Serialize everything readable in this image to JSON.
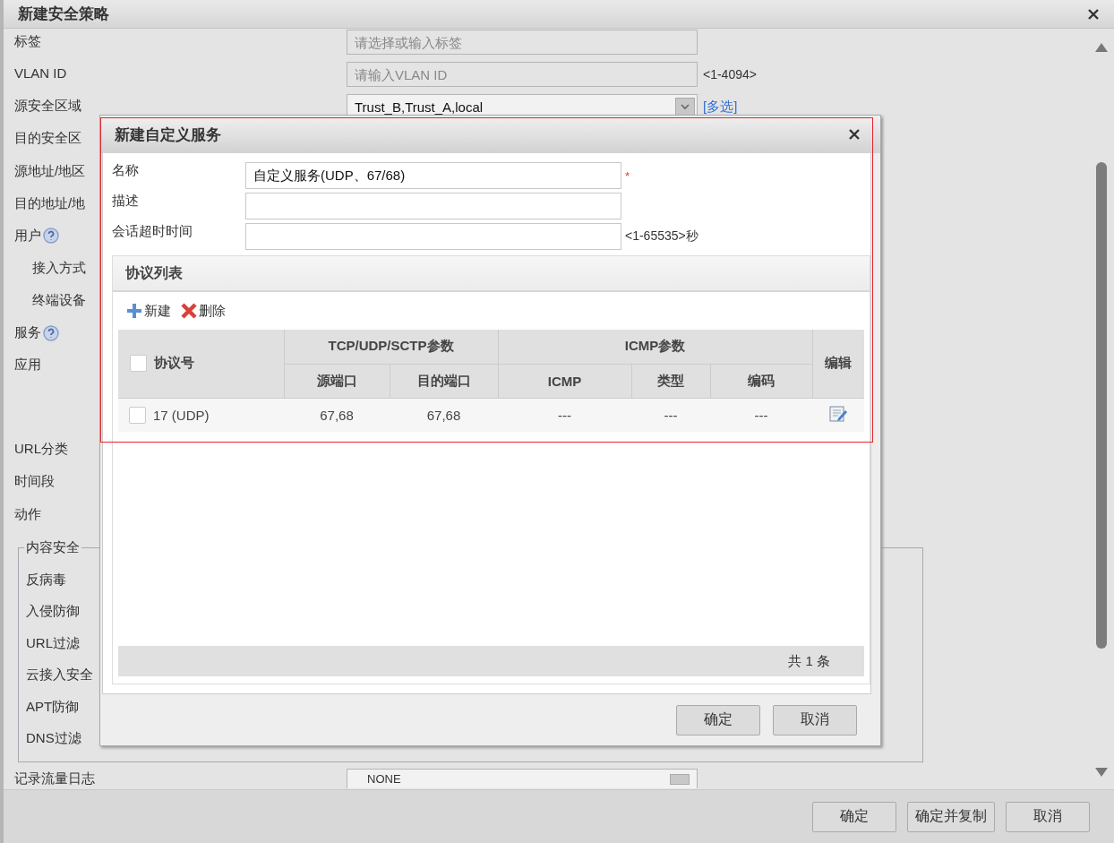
{
  "window": {
    "title": "新建安全策略"
  },
  "form": {
    "rows": [
      {
        "label": "标签",
        "control": {
          "kind": "input",
          "placeholder": "请选择或输入标签"
        }
      },
      {
        "label": "VLAN ID",
        "control": {
          "kind": "input",
          "placeholder": "请输入VLAN ID",
          "hint": "<1-4094>"
        }
      },
      {
        "label": "源安全区域",
        "control": {
          "kind": "select",
          "value": "Trust_B,Trust_A,local",
          "link": "[多选]"
        }
      },
      {
        "label": "目的安全区"
      },
      {
        "label": "源地址/地区"
      },
      {
        "label": "目的地址/地"
      },
      {
        "label": "用户",
        "help": true,
        "children": [
          {
            "label": "接入方式"
          },
          {
            "label": "终端设备"
          }
        ]
      },
      {
        "label": "服务",
        "help": true
      },
      {
        "label": "应用",
        "tall": true
      },
      {
        "label": "URL分类"
      },
      {
        "label": "时间段"
      },
      {
        "label": "动作"
      }
    ],
    "content_security": {
      "title": "内容安全",
      "items": [
        "反病毒",
        "入侵防御",
        "URL过滤",
        "云接入安全",
        "APT防御",
        "DNS过滤"
      ]
    },
    "log_row": {
      "label": "记录流量日志",
      "value": "NONE"
    }
  },
  "modal": {
    "title": "新建自定义服务",
    "fields": [
      {
        "label": "名称",
        "value": "自定义服务(UDP、67/68)",
        "required_mark": "*"
      },
      {
        "label": "描述"
      },
      {
        "label": "会话超时时间",
        "hint": "<1-65535>秒"
      }
    ],
    "protocol_list": {
      "title": "协议列表",
      "toolbar": [
        {
          "kind": "add",
          "label": "新建"
        },
        {
          "kind": "delete",
          "label": "删除"
        }
      ],
      "header_checked": false,
      "header_groups": [
        {
          "kind": "tcp",
          "label": "TCP/UDP/SCTP参数"
        },
        {
          "kind": "icmp",
          "label": "ICMP参数"
        }
      ],
      "columns": [
        {
          "label": "协议号",
          "kind": "single"
        },
        {
          "label": "源端口",
          "kind": "tcp"
        },
        {
          "label": "目的端口",
          "kind": "tcp"
        },
        {
          "label": "ICMP",
          "kind": "icmp"
        },
        {
          "label": "类型",
          "kind": "icmp"
        },
        {
          "label": "编码",
          "kind": "icmp"
        },
        {
          "label": "编辑",
          "kind": "single"
        }
      ],
      "rows": [
        {
          "checked": false,
          "cells": [
            "17 (UDP)",
            "67,68",
            "67,68",
            "---",
            "---",
            "---"
          ]
        }
      ],
      "footer": "共 1 条"
    },
    "buttons": [
      "确定",
      "取消"
    ]
  },
  "buttons": [
    "确定",
    "确定并复制",
    "取消"
  ]
}
